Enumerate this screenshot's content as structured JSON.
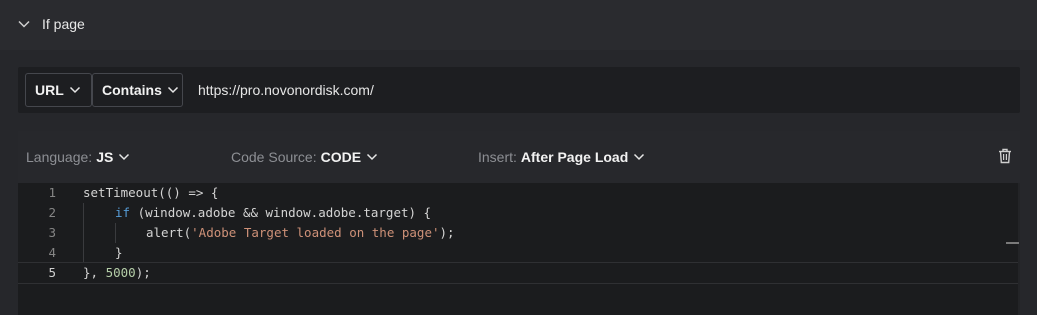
{
  "section": {
    "title": "If page"
  },
  "condition": {
    "field": "URL",
    "operator": "Contains",
    "value": "https://pro.novonordisk.com/"
  },
  "toolbar": {
    "language_label": "Language:",
    "language_value": "JS",
    "source_label": "Code Source:",
    "source_value": "CODE",
    "insert_label": "Insert:",
    "insert_value": "After Page Load"
  },
  "editor": {
    "line_numbers": [
      "1",
      "2",
      "3",
      "4",
      "5"
    ],
    "lines": {
      "l1": "setTimeout(() => {",
      "l2_kw": "if",
      "l2_rest": " (window.adobe && window.adobe.target) {",
      "l3_fn": "alert(",
      "l3_str": "'Adobe Target loaded on the page'",
      "l3_end": ");",
      "l4": "}",
      "l5_a": "}, ",
      "l5_num": "5000",
      "l5_b": ");"
    },
    "active_line": 5
  },
  "colors": {
    "background": "#26272b",
    "panel": "#1d1e21",
    "keyword": "#569cd6",
    "string": "#ce9178",
    "number": "#b5cea8"
  },
  "icons": {
    "collapse": "chevron-down-icon",
    "dropdown": "chevron-down-icon",
    "delete": "trash-icon"
  }
}
